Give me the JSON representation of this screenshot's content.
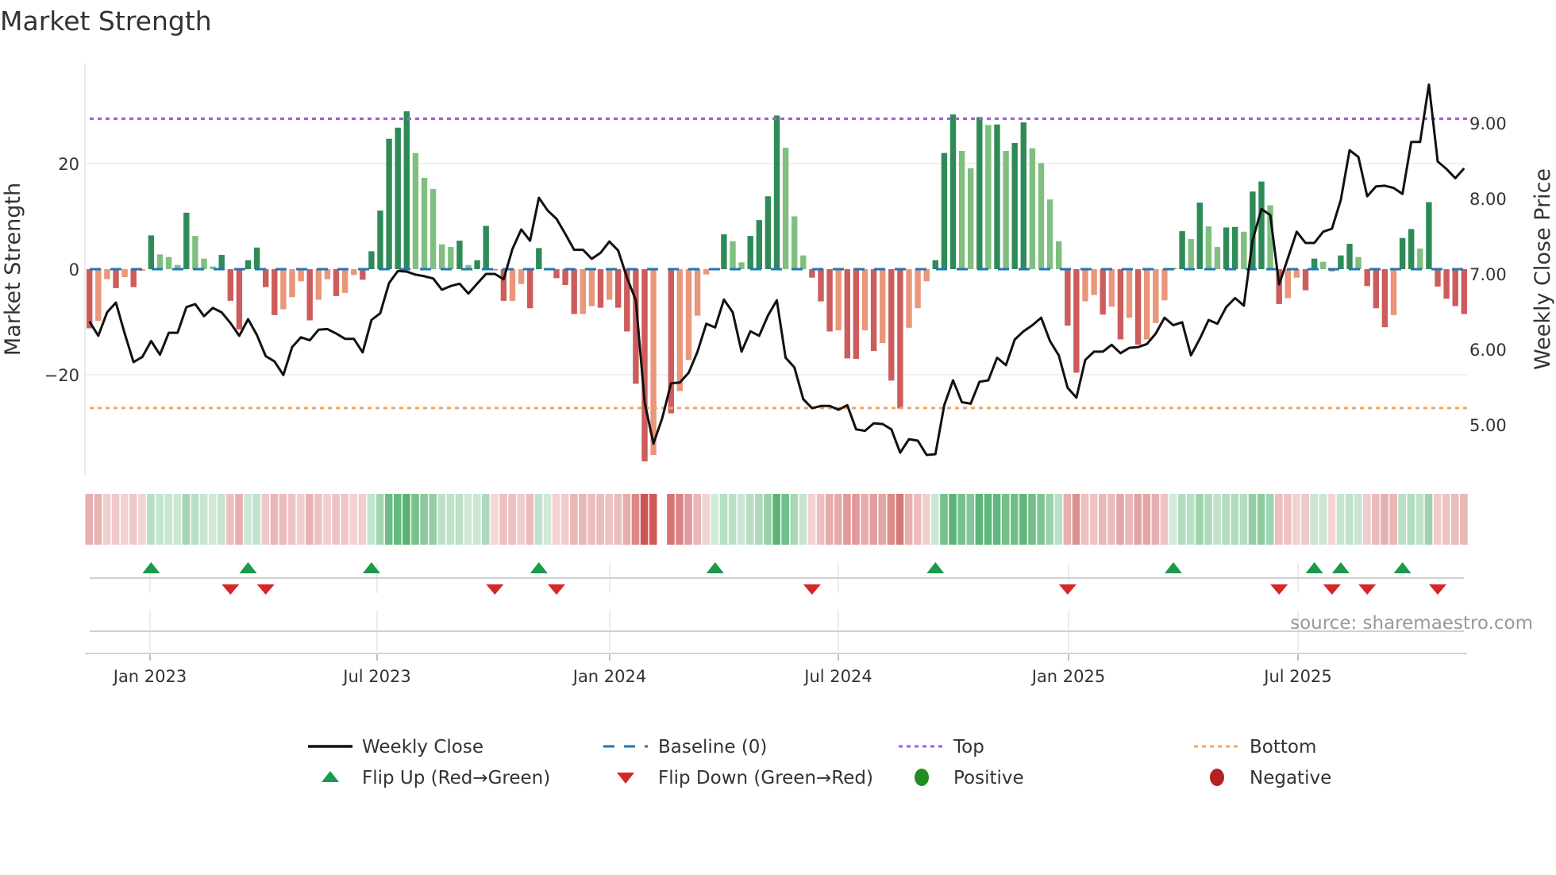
{
  "colors": {
    "pos_dark": "#2e8b57",
    "pos_light": "#80bf7f",
    "neg_dark": "#cd5c5c",
    "neg_light": "#e9967a",
    "line": "#111111",
    "baseline": "#1f77b4",
    "top": "#9b5de5",
    "bottom": "#f4a460",
    "flip_up": "#1a9a4a",
    "flip_down": "#d62728",
    "positive": "#228b22",
    "negative": "#b22222",
    "strip_pos": "46,160,80",
    "strip_neg": "200,70,70"
  },
  "chart_data": {
    "type": "bar+line",
    "title": "Market Strength",
    "ylabel": "Market Strength",
    "y2label": "Weekly Close Price",
    "ylim": [
      -37,
      36
    ],
    "y2lim": [
      4.4,
      9.7
    ],
    "y_ticks": [
      "20",
      "0",
      "−20"
    ],
    "y_tick_values": [
      20,
      0,
      -20
    ],
    "y2_ticks": [
      "9.00",
      "8.00",
      "7.00",
      "6.00",
      "5.00"
    ],
    "y2_tick_values": [
      9,
      8,
      7,
      6,
      5
    ],
    "x_ticks": [
      "Jan 2023",
      "Jul 2023",
      "Jan 2024",
      "Jul 2024",
      "Jan 2025",
      "Jul 2025"
    ],
    "start_week": "2022-11-14",
    "frequency": "weekly",
    "top_level": 28.5,
    "bottom_level": -26.3,
    "baseline": 0,
    "strength": [
      -11.2,
      -9.8,
      -1.9,
      -3.6,
      -1.5,
      -3.4,
      -0.3,
      6.4,
      2.8,
      2.3,
      0.8,
      10.7,
      6.3,
      2.0,
      0.5,
      2.7,
      -6.0,
      -11.4,
      1.7,
      4.1,
      -3.4,
      -8.7,
      -7.6,
      -5.3,
      -2.3,
      -9.7,
      -5.8,
      -1.9,
      -5.1,
      -4.5,
      -1.1,
      -2.0,
      3.4,
      11.1,
      24.7,
      26.8,
      29.9,
      22.0,
      17.3,
      15.2,
      4.7,
      4.2,
      5.4,
      0.8,
      1.7,
      8.2,
      -0.2,
      -6.0,
      -6.0,
      -2.8,
      -7.4,
      4.0,
      0.1,
      -1.7,
      -3.0,
      -8.5,
      -8.5,
      -7.0,
      -7.3,
      -5.8,
      -7.3,
      -11.8,
      -21.7,
      -36.4,
      -35.2,
      null,
      -27.3,
      -23.1,
      -17.2,
      -8.8,
      -1.0,
      0.1,
      6.6,
      5.3,
      1.3,
      6.3,
      9.3,
      13.8,
      29.1,
      23.0,
      10.0,
      2.6,
      -1.6,
      -6.1,
      -11.8,
      -11.6,
      -16.9,
      -17.0,
      -11.6,
      -15.5,
      -14.0,
      -21.1,
      -26.4,
      -11.1,
      -7.4,
      -2.3,
      1.7,
      22.0,
      29.3,
      22.4,
      19.1,
      28.8,
      27.3,
      27.4,
      22.4,
      23.9,
      27.8,
      22.9,
      20.1,
      13.2,
      5.3,
      -10.7,
      -19.6,
      -6.1,
      -4.9,
      -8.6,
      -7.1,
      -13.3,
      -9.2,
      -14.3,
      -13.3,
      -10.2,
      -5.9,
      0.2,
      7.2,
      5.7,
      12.6,
      8.1,
      4.2,
      7.9,
      8.0,
      7.1,
      14.7,
      16.6,
      12.1,
      -6.6,
      -5.5,
      -1.6,
      -4.0,
      2.0,
      1.4,
      -0.4,
      2.6,
      4.8,
      2.3,
      -3.2,
      -7.4,
      -11.0,
      -8.7,
      5.9,
      7.6,
      3.9,
      12.7,
      -3.3,
      -5.6,
      -7.0,
      -8.5
    ],
    "weekly_close": [
      6.37,
      6.18,
      6.49,
      6.62,
      6.21,
      5.83,
      5.9,
      6.11,
      5.93,
      6.22,
      6.22,
      6.56,
      6.6,
      6.44,
      6.55,
      6.49,
      6.35,
      6.18,
      6.4,
      6.19,
      5.91,
      5.84,
      5.66,
      6.03,
      6.16,
      6.12,
      6.26,
      6.27,
      6.21,
      6.14,
      6.14,
      5.96,
      6.39,
      6.48,
      6.88,
      7.04,
      7.03,
      6.99,
      6.97,
      6.94,
      6.79,
      6.84,
      6.87,
      6.74,
      6.87,
      7.0,
      7.0,
      6.93,
      7.33,
      7.59,
      7.44,
      8.01,
      7.84,
      7.73,
      7.53,
      7.32,
      7.32,
      7.2,
      7.28,
      7.43,
      7.31,
      6.95,
      6.65,
      5.3,
      4.75,
      5.09,
      5.55,
      5.56,
      5.69,
      5.97,
      6.34,
      6.29,
      6.66,
      6.49,
      5.97,
      6.24,
      6.18,
      6.45,
      6.65,
      5.89,
      5.76,
      5.34,
      5.22,
      5.25,
      5.25,
      5.2,
      5.26,
      4.94,
      4.92,
      5.02,
      5.01,
      4.94,
      4.63,
      4.81,
      4.79,
      4.6,
      4.61,
      5.26,
      5.59,
      5.3,
      5.28,
      5.57,
      5.59,
      5.89,
      5.79,
      6.13,
      6.24,
      6.32,
      6.42,
      6.11,
      5.92,
      5.49,
      5.36,
      5.86,
      5.97,
      5.97,
      6.06,
      5.95,
      6.02,
      6.03,
      6.07,
      6.21,
      6.42,
      6.32,
      6.36,
      5.92,
      6.14,
      6.39,
      6.34,
      6.56,
      6.68,
      6.58,
      7.45,
      7.86,
      7.78,
      6.86,
      7.21,
      7.56,
      7.41,
      7.41,
      7.56,
      7.6,
      7.98,
      8.64,
      8.55,
      8.03,
      8.16,
      8.17,
      8.14,
      8.06,
      8.75,
      8.75,
      9.51,
      8.49,
      8.39,
      8.27,
      8.4
    ],
    "legend_placement": "bottom",
    "grid": true
  },
  "legend": {
    "weekly_close": "Weekly Close",
    "baseline": "Baseline (0)",
    "top": "Top",
    "bottom": "Bottom",
    "flip_up": "Flip Up (Red→Green)",
    "flip_down": "Flip Down (Green→Red)",
    "positive": "Positive",
    "negative": "Negative"
  },
  "source": "source: sharemaestro.com"
}
